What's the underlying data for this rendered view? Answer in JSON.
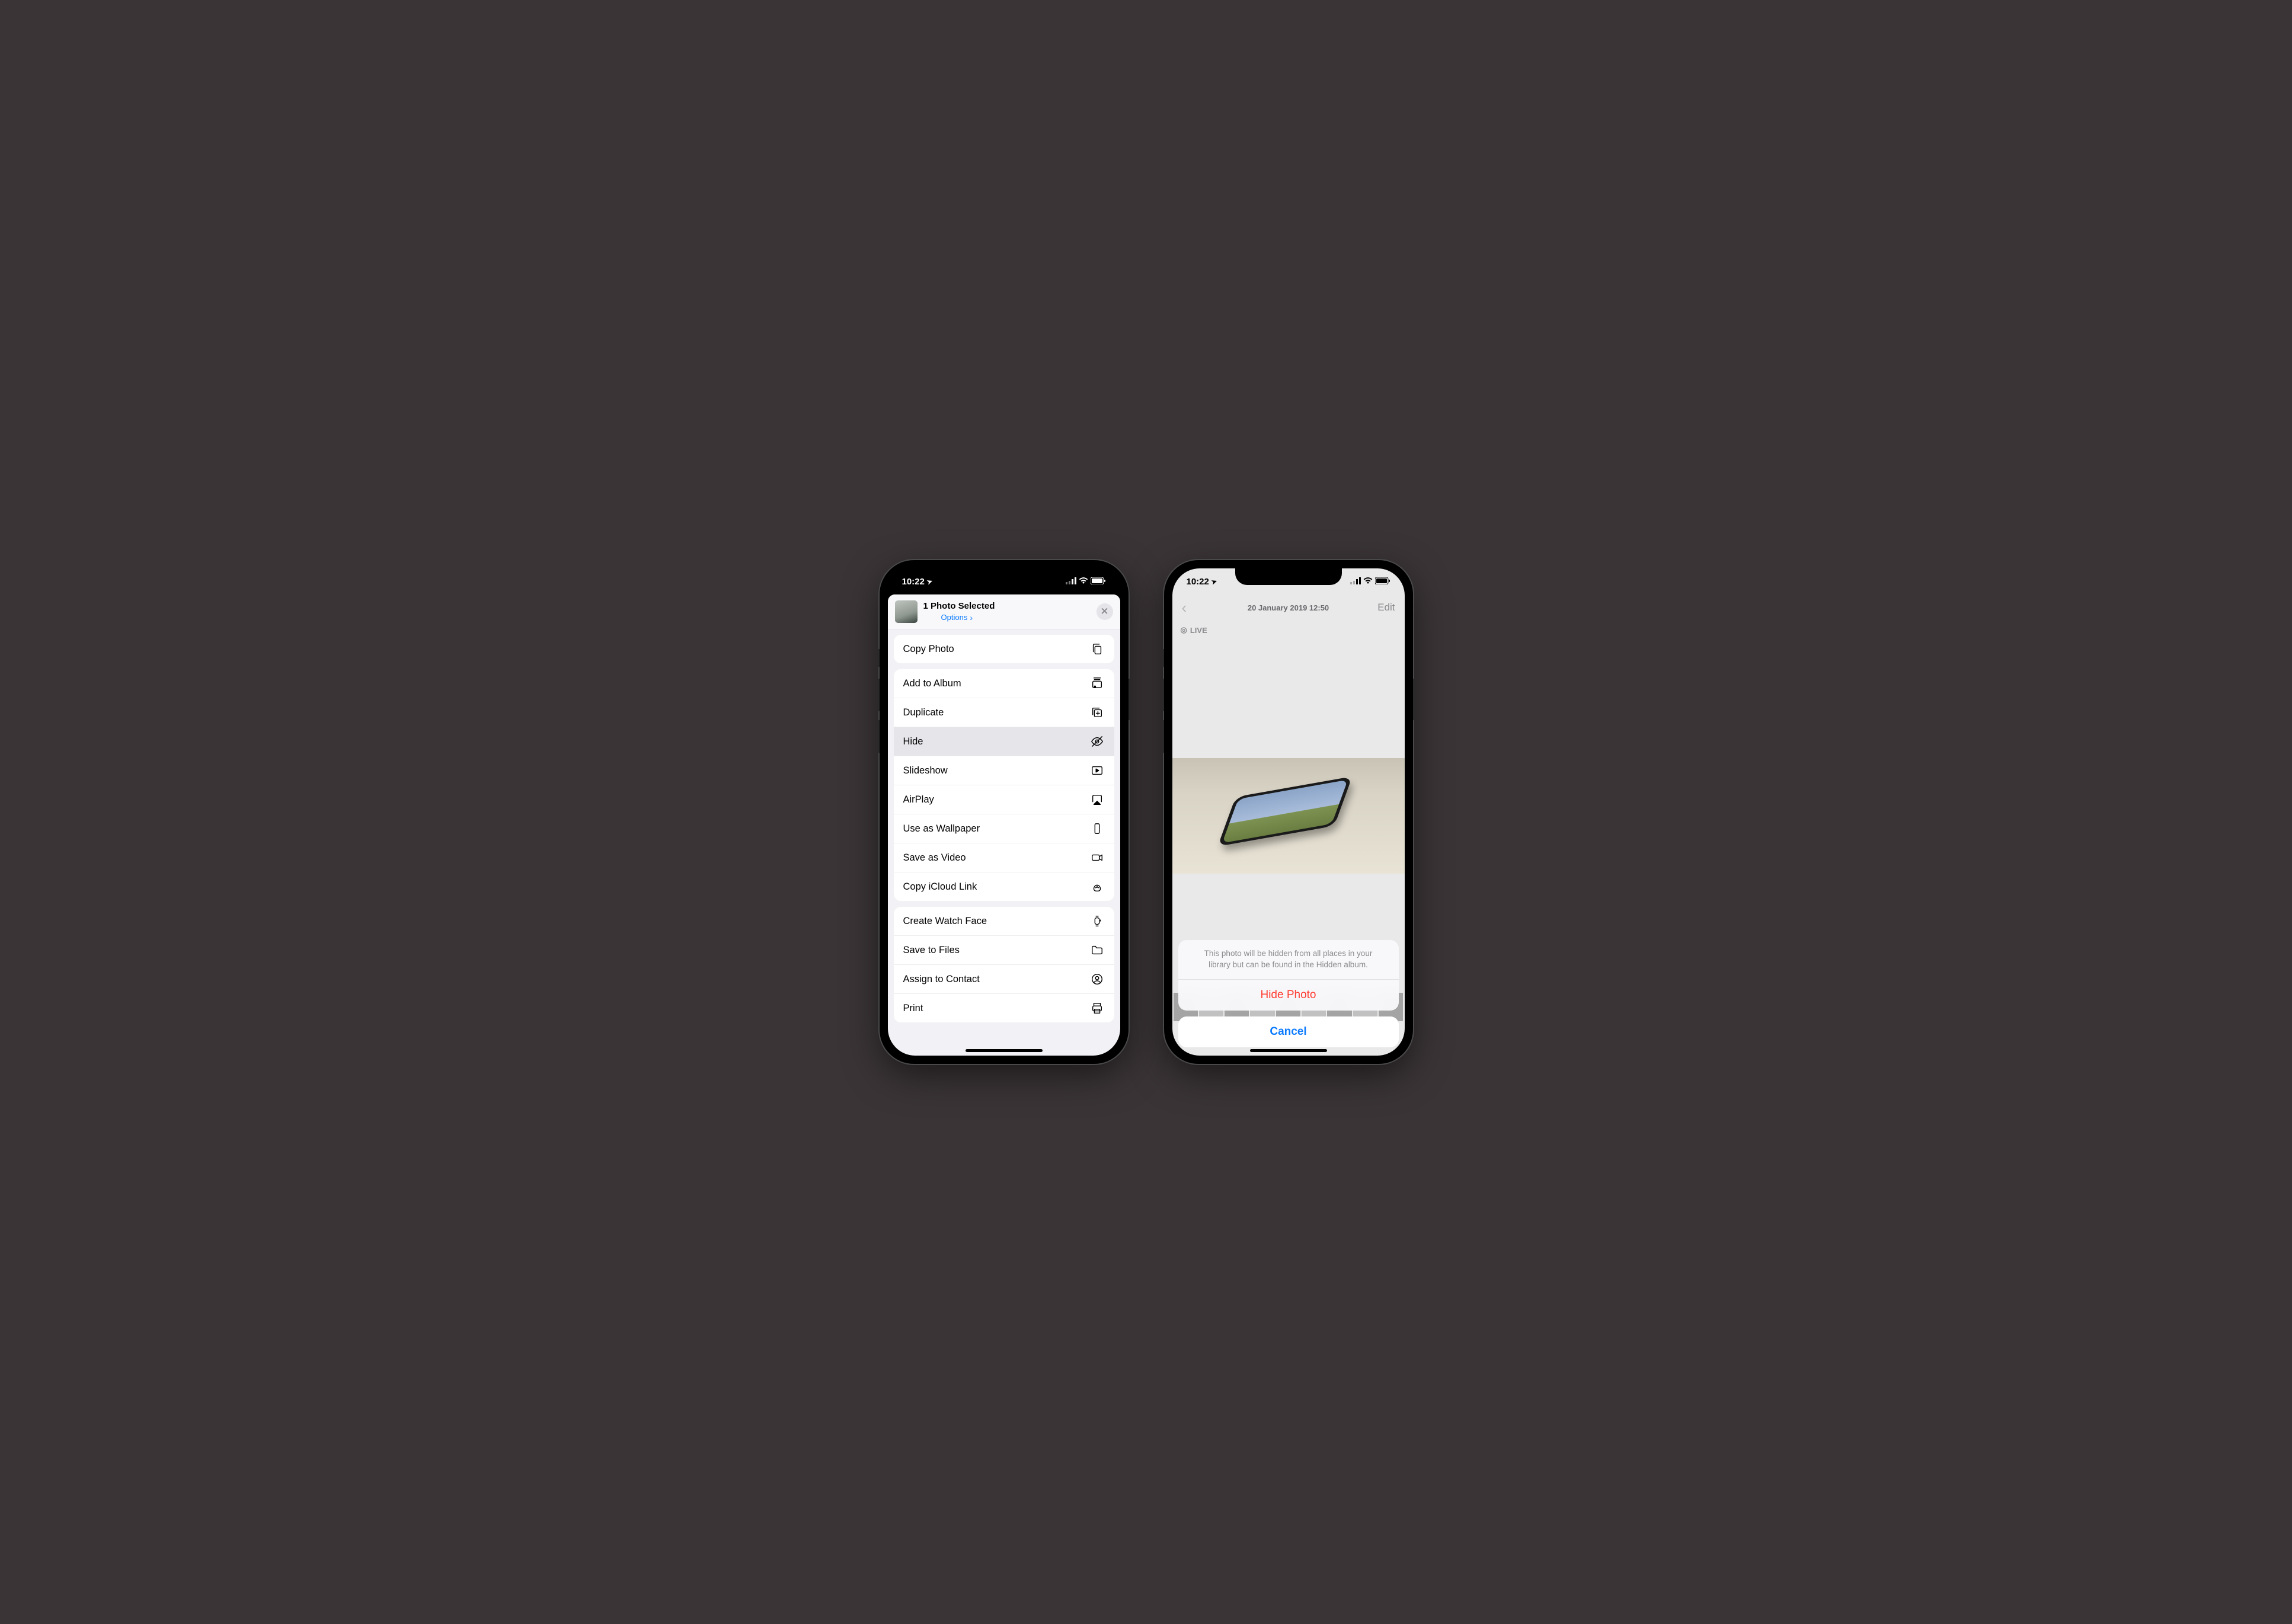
{
  "status": {
    "time": "10:22",
    "location_glyph": "➤"
  },
  "share": {
    "title": "1 Photo Selected",
    "options_label": "Options",
    "actions": [
      {
        "label": "Copy Photo",
        "icon": "copy"
      },
      {
        "label": "Add to Album",
        "icon": "album"
      },
      {
        "label": "Duplicate",
        "icon": "duplicate"
      },
      {
        "label": "Hide",
        "icon": "hide",
        "highlighted": true
      },
      {
        "label": "Slideshow",
        "icon": "slideshow"
      },
      {
        "label": "AirPlay",
        "icon": "airplay"
      },
      {
        "label": "Use as Wallpaper",
        "icon": "wallpaper"
      },
      {
        "label": "Save as Video",
        "icon": "video"
      },
      {
        "label": "Copy iCloud Link",
        "icon": "link"
      },
      {
        "label": "Create Watch Face",
        "icon": "watch"
      },
      {
        "label": "Save to Files",
        "icon": "folder"
      },
      {
        "label": "Assign to Contact",
        "icon": "contact"
      },
      {
        "label": "Print",
        "icon": "print"
      }
    ]
  },
  "detail": {
    "date": "20 January 2019  12:50",
    "edit_label": "Edit",
    "live_label": "LIVE"
  },
  "sheet": {
    "message": "This photo will be hidden from all places in your library but can be found in the Hidden album.",
    "destructive_label": "Hide Photo",
    "cancel_label": "Cancel"
  }
}
